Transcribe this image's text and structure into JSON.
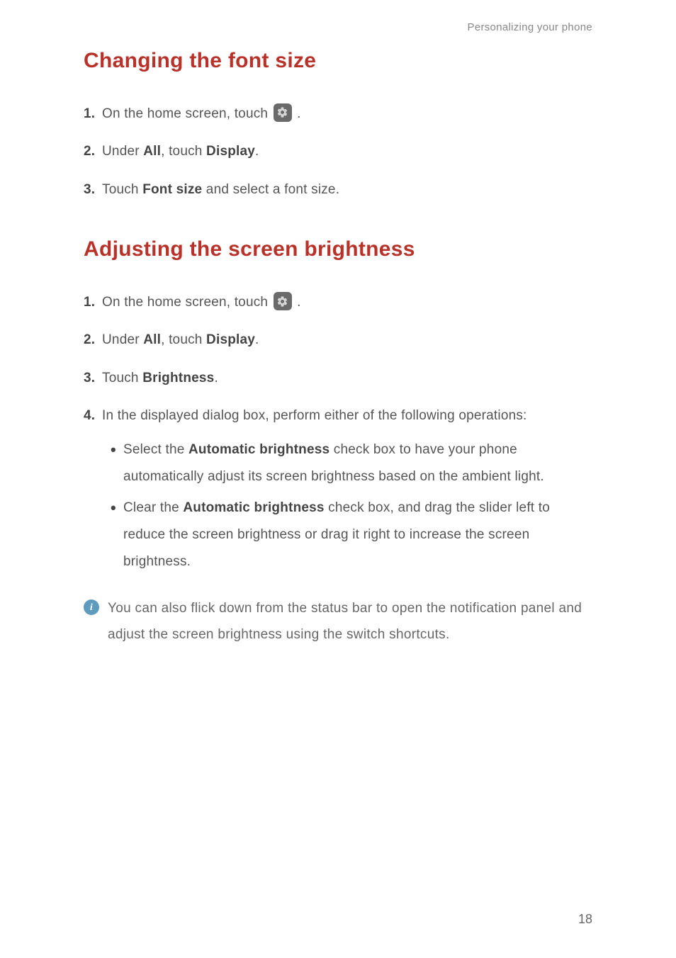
{
  "chapter_hint": "Personalizing your phone",
  "sections": {
    "font": {
      "title": "Changing the font size",
      "steps": {
        "s1": {
          "num": "1.",
          "pre": "On the home screen, touch ",
          "post": " ."
        },
        "s2": {
          "num": "2.",
          "t0": "Under ",
          "b0": "All",
          "t1": ", touch ",
          "b1": "Display",
          "t2": "."
        },
        "s3": {
          "num": "3.",
          "t0": "Touch ",
          "b0": "Font size",
          "t1": " and select a font size."
        }
      }
    },
    "brightness": {
      "title": "Adjusting the screen brightness",
      "steps": {
        "s1": {
          "num": "1.",
          "pre": "On the home screen, touch ",
          "post": " ."
        },
        "s2": {
          "num": "2.",
          "t0": "Under ",
          "b0": "All",
          "t1": ", touch ",
          "b1": "Display",
          "t2": "."
        },
        "s3": {
          "num": "3.",
          "t0": "Touch ",
          "b0": "Brightness",
          "t1": "."
        },
        "s4": {
          "num": "4.",
          "lead": "In the displayed dialog box, perform either of the following operations:",
          "bullets": {
            "b1": {
              "t0": "Select the ",
              "b0": "Automatic brightness",
              "t1": " check box to have your phone automatically adjust its screen brightness based on the ambient light."
            },
            "b2": {
              "t0": "Clear the ",
              "b0": "Automatic brightness",
              "t1": " check box, and drag the slider left to reduce the screen brightness or drag it right to increase the screen brightness."
            }
          }
        }
      },
      "info": "You can also flick down from the status bar to open the notification panel and adjust the screen brightness using the switch shortcuts."
    }
  },
  "page_number": "18",
  "icons": {
    "info_glyph": "i"
  }
}
